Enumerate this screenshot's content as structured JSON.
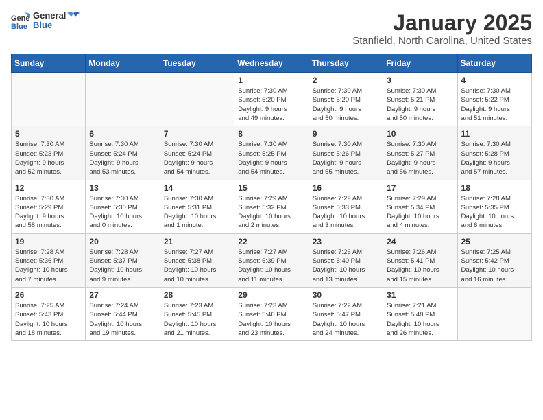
{
  "header": {
    "logo_general": "General",
    "logo_blue": "Blue",
    "month_title": "January 2025",
    "location": "Stanfield, North Carolina, United States"
  },
  "weekdays": [
    "Sunday",
    "Monday",
    "Tuesday",
    "Wednesday",
    "Thursday",
    "Friday",
    "Saturday"
  ],
  "weeks": [
    [
      {
        "day": "",
        "info": ""
      },
      {
        "day": "",
        "info": ""
      },
      {
        "day": "",
        "info": ""
      },
      {
        "day": "1",
        "info": "Sunrise: 7:30 AM\nSunset: 5:20 PM\nDaylight: 9 hours\nand 49 minutes."
      },
      {
        "day": "2",
        "info": "Sunrise: 7:30 AM\nSunset: 5:20 PM\nDaylight: 9 hours\nand 50 minutes."
      },
      {
        "day": "3",
        "info": "Sunrise: 7:30 AM\nSunset: 5:21 PM\nDaylight: 9 hours\nand 50 minutes."
      },
      {
        "day": "4",
        "info": "Sunrise: 7:30 AM\nSunset: 5:22 PM\nDaylight: 9 hours\nand 51 minutes."
      }
    ],
    [
      {
        "day": "5",
        "info": "Sunrise: 7:30 AM\nSunset: 5:23 PM\nDaylight: 9 hours\nand 52 minutes."
      },
      {
        "day": "6",
        "info": "Sunrise: 7:30 AM\nSunset: 5:24 PM\nDaylight: 9 hours\nand 53 minutes."
      },
      {
        "day": "7",
        "info": "Sunrise: 7:30 AM\nSunset: 5:24 PM\nDaylight: 9 hours\nand 54 minutes."
      },
      {
        "day": "8",
        "info": "Sunrise: 7:30 AM\nSunset: 5:25 PM\nDaylight: 9 hours\nand 54 minutes."
      },
      {
        "day": "9",
        "info": "Sunrise: 7:30 AM\nSunset: 5:26 PM\nDaylight: 9 hours\nand 55 minutes."
      },
      {
        "day": "10",
        "info": "Sunrise: 7:30 AM\nSunset: 5:27 PM\nDaylight: 9 hours\nand 56 minutes."
      },
      {
        "day": "11",
        "info": "Sunrise: 7:30 AM\nSunset: 5:28 PM\nDaylight: 9 hours\nand 57 minutes."
      }
    ],
    [
      {
        "day": "12",
        "info": "Sunrise: 7:30 AM\nSunset: 5:29 PM\nDaylight: 9 hours\nand 58 minutes."
      },
      {
        "day": "13",
        "info": "Sunrise: 7:30 AM\nSunset: 5:30 PM\nDaylight: 10 hours\nand 0 minutes."
      },
      {
        "day": "14",
        "info": "Sunrise: 7:30 AM\nSunset: 5:31 PM\nDaylight: 10 hours\nand 1 minute."
      },
      {
        "day": "15",
        "info": "Sunrise: 7:29 AM\nSunset: 5:32 PM\nDaylight: 10 hours\nand 2 minutes."
      },
      {
        "day": "16",
        "info": "Sunrise: 7:29 AM\nSunset: 5:33 PM\nDaylight: 10 hours\nand 3 minutes."
      },
      {
        "day": "17",
        "info": "Sunrise: 7:29 AM\nSunset: 5:34 PM\nDaylight: 10 hours\nand 4 minutes."
      },
      {
        "day": "18",
        "info": "Sunrise: 7:28 AM\nSunset: 5:35 PM\nDaylight: 10 hours\nand 6 minutes."
      }
    ],
    [
      {
        "day": "19",
        "info": "Sunrise: 7:28 AM\nSunset: 5:36 PM\nDaylight: 10 hours\nand 7 minutes."
      },
      {
        "day": "20",
        "info": "Sunrise: 7:28 AM\nSunset: 5:37 PM\nDaylight: 10 hours\nand 9 minutes."
      },
      {
        "day": "21",
        "info": "Sunrise: 7:27 AM\nSunset: 5:38 PM\nDaylight: 10 hours\nand 10 minutes."
      },
      {
        "day": "22",
        "info": "Sunrise: 7:27 AM\nSunset: 5:39 PM\nDaylight: 10 hours\nand 11 minutes."
      },
      {
        "day": "23",
        "info": "Sunrise: 7:26 AM\nSunset: 5:40 PM\nDaylight: 10 hours\nand 13 minutes."
      },
      {
        "day": "24",
        "info": "Sunrise: 7:26 AM\nSunset: 5:41 PM\nDaylight: 10 hours\nand 15 minutes."
      },
      {
        "day": "25",
        "info": "Sunrise: 7:25 AM\nSunset: 5:42 PM\nDaylight: 10 hours\nand 16 minutes."
      }
    ],
    [
      {
        "day": "26",
        "info": "Sunrise: 7:25 AM\nSunset: 5:43 PM\nDaylight: 10 hours\nand 18 minutes."
      },
      {
        "day": "27",
        "info": "Sunrise: 7:24 AM\nSunset: 5:44 PM\nDaylight: 10 hours\nand 19 minutes."
      },
      {
        "day": "28",
        "info": "Sunrise: 7:23 AM\nSunset: 5:45 PM\nDaylight: 10 hours\nand 21 minutes."
      },
      {
        "day": "29",
        "info": "Sunrise: 7:23 AM\nSunset: 5:46 PM\nDaylight: 10 hours\nand 23 minutes."
      },
      {
        "day": "30",
        "info": "Sunrise: 7:22 AM\nSunset: 5:47 PM\nDaylight: 10 hours\nand 24 minutes."
      },
      {
        "day": "31",
        "info": "Sunrise: 7:21 AM\nSunset: 5:48 PM\nDaylight: 10 hours\nand 26 minutes."
      },
      {
        "day": "",
        "info": ""
      }
    ]
  ]
}
